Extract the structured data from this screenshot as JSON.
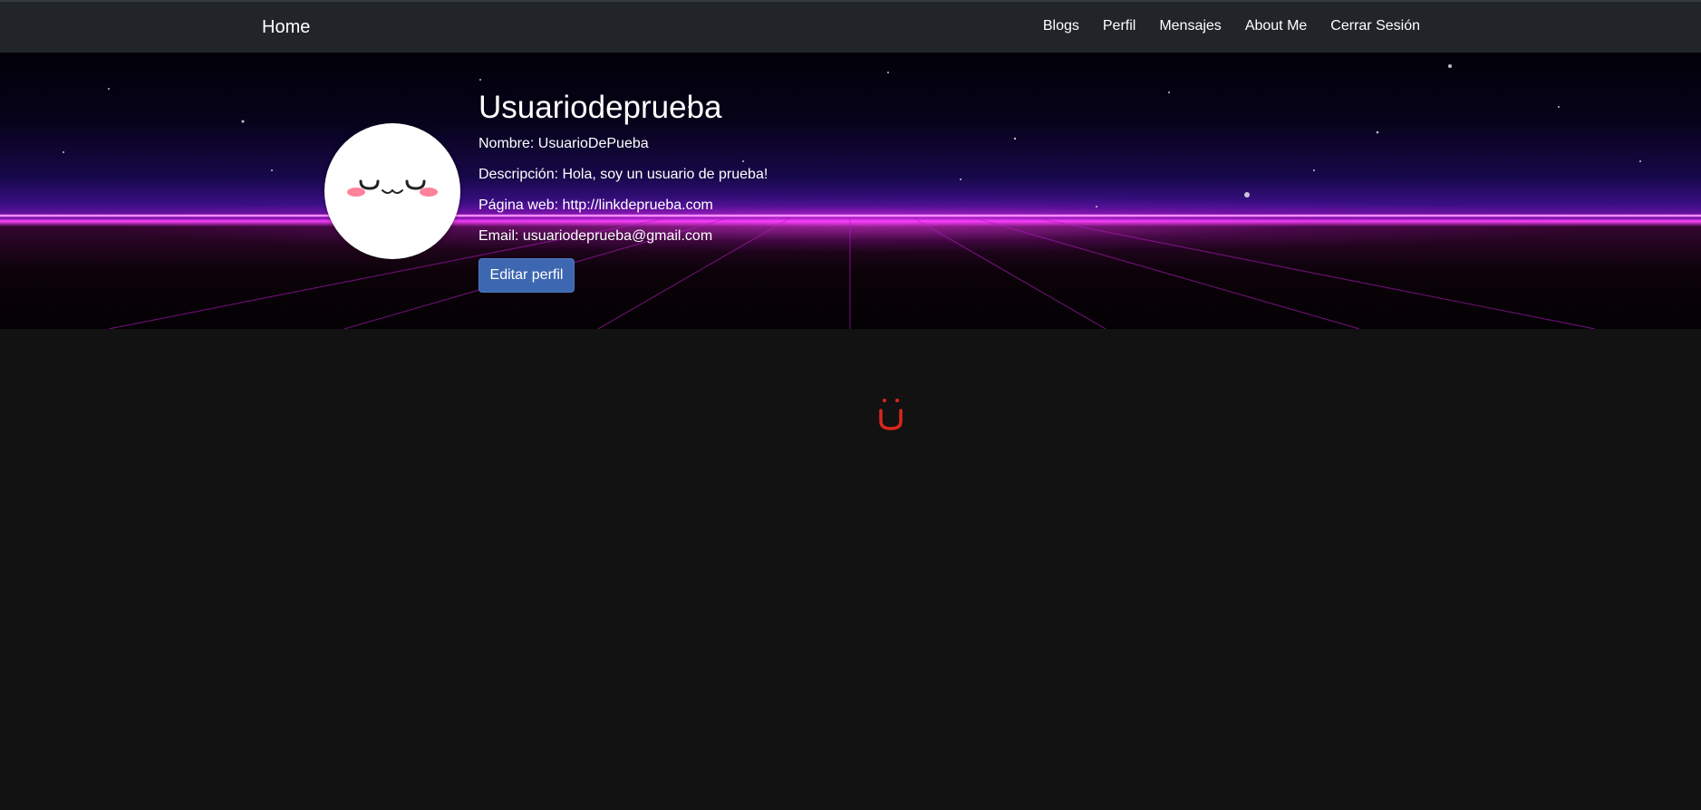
{
  "navbar": {
    "brand": "Home",
    "links": [
      {
        "label": "Blogs"
      },
      {
        "label": "Perfil"
      },
      {
        "label": "Mensajes"
      },
      {
        "label": "About Me"
      },
      {
        "label": "Cerrar Sesión"
      }
    ]
  },
  "profile": {
    "username": "Usuariodeprueba",
    "nombre": "Nombre: UsuarioDePueba",
    "descripcion": "Descripción: Hola, soy un usuario de prueba!",
    "pagina_web": "Página web: http://linkdeprueba.com",
    "email": "Email: usuariodeprueba@gmail.com",
    "edit_button": "Editar perfil",
    "avatar_icon": "sleepy-face-icon"
  },
  "content": {
    "smiley_icon": "red-smiley-icon"
  },
  "colors": {
    "navbar_bg": "#212529",
    "page_bg": "#121212",
    "button_bg": "#3d67b0",
    "smiley": "#d8261d",
    "horizon_glow": "#ff46ff"
  }
}
